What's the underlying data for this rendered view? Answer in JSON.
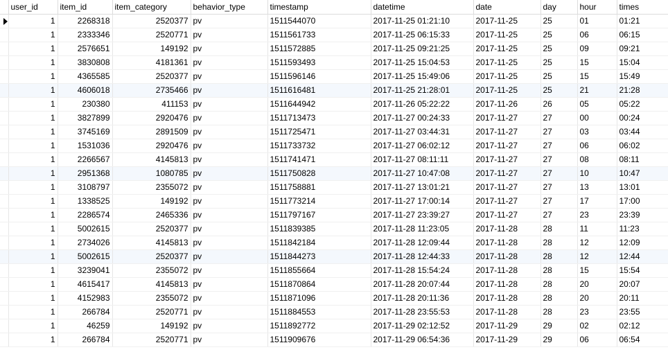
{
  "columns": [
    "user_id",
    "item_id",
    "item_category",
    "behavior_type",
    "timestamp",
    "datetime",
    "date",
    "day",
    "hour",
    "times"
  ],
  "rows": [
    {
      "current": true,
      "user_id": "1",
      "item_id": "2268318",
      "item_category": "2520377",
      "behavior_type": "pv",
      "timestamp": "1511544070",
      "datetime": "2017-11-25 01:21:10",
      "date": "2017-11-25",
      "day": "25",
      "hour": "01",
      "times": "01:21"
    },
    {
      "current": false,
      "user_id": "1",
      "item_id": "2333346",
      "item_category": "2520771",
      "behavior_type": "pv",
      "timestamp": "1511561733",
      "datetime": "2017-11-25 06:15:33",
      "date": "2017-11-25",
      "day": "25",
      "hour": "06",
      "times": "06:15"
    },
    {
      "current": false,
      "user_id": "1",
      "item_id": "2576651",
      "item_category": "149192",
      "behavior_type": "pv",
      "timestamp": "1511572885",
      "datetime": "2017-11-25 09:21:25",
      "date": "2017-11-25",
      "day": "25",
      "hour": "09",
      "times": "09:21"
    },
    {
      "current": false,
      "user_id": "1",
      "item_id": "3830808",
      "item_category": "4181361",
      "behavior_type": "pv",
      "timestamp": "1511593493",
      "datetime": "2017-11-25 15:04:53",
      "date": "2017-11-25",
      "day": "25",
      "hour": "15",
      "times": "15:04"
    },
    {
      "current": false,
      "user_id": "1",
      "item_id": "4365585",
      "item_category": "2520377",
      "behavior_type": "pv",
      "timestamp": "1511596146",
      "datetime": "2017-11-25 15:49:06",
      "date": "2017-11-25",
      "day": "25",
      "hour": "15",
      "times": "15:49"
    },
    {
      "current": false,
      "user_id": "1",
      "item_id": "4606018",
      "item_category": "2735466",
      "behavior_type": "pv",
      "timestamp": "1511616481",
      "datetime": "2017-11-25 21:28:01",
      "date": "2017-11-25",
      "day": "25",
      "hour": "21",
      "times": "21:28"
    },
    {
      "current": false,
      "user_id": "1",
      "item_id": "230380",
      "item_category": "411153",
      "behavior_type": "pv",
      "timestamp": "1511644942",
      "datetime": "2017-11-26 05:22:22",
      "date": "2017-11-26",
      "day": "26",
      "hour": "05",
      "times": "05:22"
    },
    {
      "current": false,
      "user_id": "1",
      "item_id": "3827899",
      "item_category": "2920476",
      "behavior_type": "pv",
      "timestamp": "1511713473",
      "datetime": "2017-11-27 00:24:33",
      "date": "2017-11-27",
      "day": "27",
      "hour": "00",
      "times": "00:24"
    },
    {
      "current": false,
      "user_id": "1",
      "item_id": "3745169",
      "item_category": "2891509",
      "behavior_type": "pv",
      "timestamp": "1511725471",
      "datetime": "2017-11-27 03:44:31",
      "date": "2017-11-27",
      "day": "27",
      "hour": "03",
      "times": "03:44"
    },
    {
      "current": false,
      "user_id": "1",
      "item_id": "1531036",
      "item_category": "2920476",
      "behavior_type": "pv",
      "timestamp": "1511733732",
      "datetime": "2017-11-27 06:02:12",
      "date": "2017-11-27",
      "day": "27",
      "hour": "06",
      "times": "06:02"
    },
    {
      "current": false,
      "user_id": "1",
      "item_id": "2266567",
      "item_category": "4145813",
      "behavior_type": "pv",
      "timestamp": "1511741471",
      "datetime": "2017-11-27 08:11:11",
      "date": "2017-11-27",
      "day": "27",
      "hour": "08",
      "times": "08:11"
    },
    {
      "current": false,
      "user_id": "1",
      "item_id": "2951368",
      "item_category": "1080785",
      "behavior_type": "pv",
      "timestamp": "1511750828",
      "datetime": "2017-11-27 10:47:08",
      "date": "2017-11-27",
      "day": "27",
      "hour": "10",
      "times": "10:47"
    },
    {
      "current": false,
      "user_id": "1",
      "item_id": "3108797",
      "item_category": "2355072",
      "behavior_type": "pv",
      "timestamp": "1511758881",
      "datetime": "2017-11-27 13:01:21",
      "date": "2017-11-27",
      "day": "27",
      "hour": "13",
      "times": "13:01"
    },
    {
      "current": false,
      "user_id": "1",
      "item_id": "1338525",
      "item_category": "149192",
      "behavior_type": "pv",
      "timestamp": "1511773214",
      "datetime": "2017-11-27 17:00:14",
      "date": "2017-11-27",
      "day": "27",
      "hour": "17",
      "times": "17:00"
    },
    {
      "current": false,
      "user_id": "1",
      "item_id": "2286574",
      "item_category": "2465336",
      "behavior_type": "pv",
      "timestamp": "1511797167",
      "datetime": "2017-11-27 23:39:27",
      "date": "2017-11-27",
      "day": "27",
      "hour": "23",
      "times": "23:39"
    },
    {
      "current": false,
      "user_id": "1",
      "item_id": "5002615",
      "item_category": "2520377",
      "behavior_type": "pv",
      "timestamp": "1511839385",
      "datetime": "2017-11-28 11:23:05",
      "date": "2017-11-28",
      "day": "28",
      "hour": "11",
      "times": "11:23"
    },
    {
      "current": false,
      "user_id": "1",
      "item_id": "2734026",
      "item_category": "4145813",
      "behavior_type": "pv",
      "timestamp": "1511842184",
      "datetime": "2017-11-28 12:09:44",
      "date": "2017-11-28",
      "day": "28",
      "hour": "12",
      "times": "12:09"
    },
    {
      "current": false,
      "user_id": "1",
      "item_id": "5002615",
      "item_category": "2520377",
      "behavior_type": "pv",
      "timestamp": "1511844273",
      "datetime": "2017-11-28 12:44:33",
      "date": "2017-11-28",
      "day": "28",
      "hour": "12",
      "times": "12:44"
    },
    {
      "current": false,
      "user_id": "1",
      "item_id": "3239041",
      "item_category": "2355072",
      "behavior_type": "pv",
      "timestamp": "1511855664",
      "datetime": "2017-11-28 15:54:24",
      "date": "2017-11-28",
      "day": "28",
      "hour": "15",
      "times": "15:54"
    },
    {
      "current": false,
      "user_id": "1",
      "item_id": "4615417",
      "item_category": "4145813",
      "behavior_type": "pv",
      "timestamp": "1511870864",
      "datetime": "2017-11-28 20:07:44",
      "date": "2017-11-28",
      "day": "28",
      "hour": "20",
      "times": "20:07"
    },
    {
      "current": false,
      "user_id": "1",
      "item_id": "4152983",
      "item_category": "2355072",
      "behavior_type": "pv",
      "timestamp": "1511871096",
      "datetime": "2017-11-28 20:11:36",
      "date": "2017-11-28",
      "day": "28",
      "hour": "20",
      "times": "20:11"
    },
    {
      "current": false,
      "user_id": "1",
      "item_id": "266784",
      "item_category": "2520771",
      "behavior_type": "pv",
      "timestamp": "1511884553",
      "datetime": "2017-11-28 23:55:53",
      "date": "2017-11-28",
      "day": "28",
      "hour": "23",
      "times": "23:55"
    },
    {
      "current": false,
      "user_id": "1",
      "item_id": "46259",
      "item_category": "149192",
      "behavior_type": "pv",
      "timestamp": "1511892772",
      "datetime": "2017-11-29 02:12:52",
      "date": "2017-11-29",
      "day": "29",
      "hour": "02",
      "times": "02:12"
    },
    {
      "current": false,
      "user_id": "1",
      "item_id": "266784",
      "item_category": "2520771",
      "behavior_type": "pv",
      "timestamp": "1511909676",
      "datetime": "2017-11-29 06:54:36",
      "date": "2017-11-29",
      "day": "29",
      "hour": "06",
      "times": "06:54"
    }
  ],
  "colors": {
    "alt_row": "#f4f8fd",
    "grid_line": "#e6e6e6"
  },
  "icons": {
    "current_row": "triangle-right-icon"
  }
}
